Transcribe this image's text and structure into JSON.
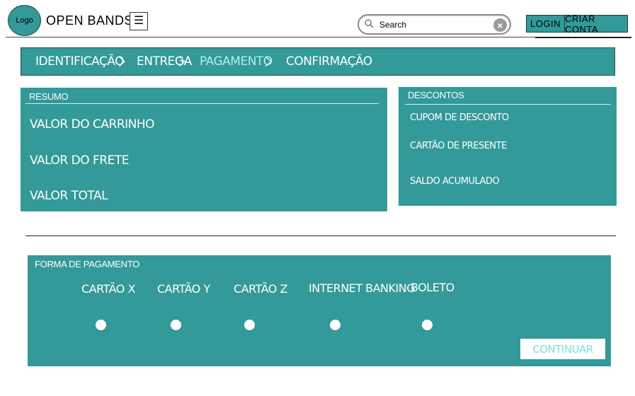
{
  "header": {
    "logo_text": "Logo",
    "brand": "OPEN BANDS",
    "menu_icon": "hamburger-icon",
    "search": {
      "placeholder": "Search",
      "value": ""
    },
    "login_label": "LOGIN",
    "signup_label": "CRIAR CONTA"
  },
  "steps": {
    "items": [
      {
        "label": "IDENTIFICAÇÃO",
        "active": false
      },
      {
        "label": "ENTREGA",
        "active": false
      },
      {
        "label": "PAGAMENTO",
        "active": true
      },
      {
        "label": "CONFIRMAÇÃO",
        "active": false
      }
    ]
  },
  "resumo": {
    "title": "RESUMO",
    "items": [
      "VALOR DO CARRINHO",
      "VALOR DO FRETE",
      "VALOR TOTAL"
    ]
  },
  "descontos": {
    "title": "DESCONTOS",
    "items": [
      "CUPOM DE DESCONTO",
      "CARTÃO DE PRESENTE",
      "SALDO ACUMULADO"
    ]
  },
  "pagamento": {
    "title": "FORMA DE PAGAMENTO",
    "options": [
      "CARTÃO X",
      "CARTÃO Y",
      "CARTÃO Z",
      "INTERNET BANKING",
      "BOLETO"
    ],
    "continue_label": "CONTINUAR"
  },
  "colors": {
    "teal": "#339999",
    "active_step": "#aef0ee",
    "continue_text": "#7fdede"
  }
}
